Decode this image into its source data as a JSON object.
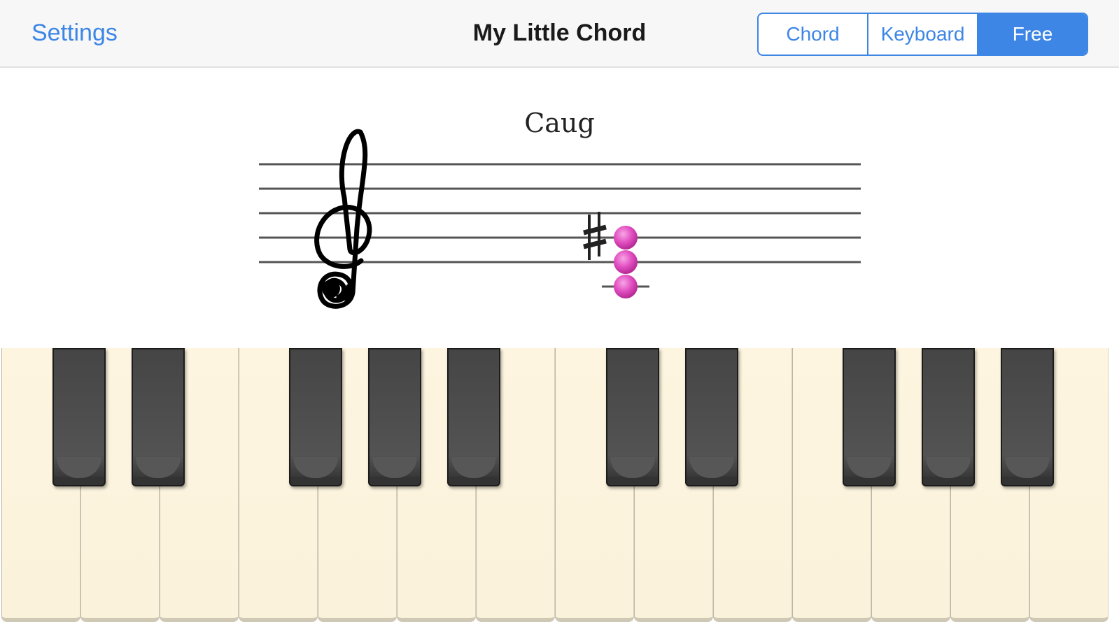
{
  "navbar": {
    "settings_label": "Settings",
    "title": "My Little Chord",
    "segments": [
      {
        "label": "Chord",
        "selected": false
      },
      {
        "label": "Keyboard",
        "selected": false
      },
      {
        "label": "Free",
        "selected": true
      }
    ]
  },
  "staff": {
    "chord_name": "Caug",
    "clef": "treble-clef",
    "accidental": "sharp",
    "notes": [
      "C4",
      "E4",
      "G#4"
    ],
    "note_color": "#e24fc1"
  },
  "piano": {
    "white_key_count": 14,
    "black_key_count": 10,
    "white_key_color": "#fdf5df",
    "black_key_color": "#4a4a4a"
  },
  "colors": {
    "accent": "#3d86e6",
    "navbar_bg": "#f7f7f7"
  }
}
